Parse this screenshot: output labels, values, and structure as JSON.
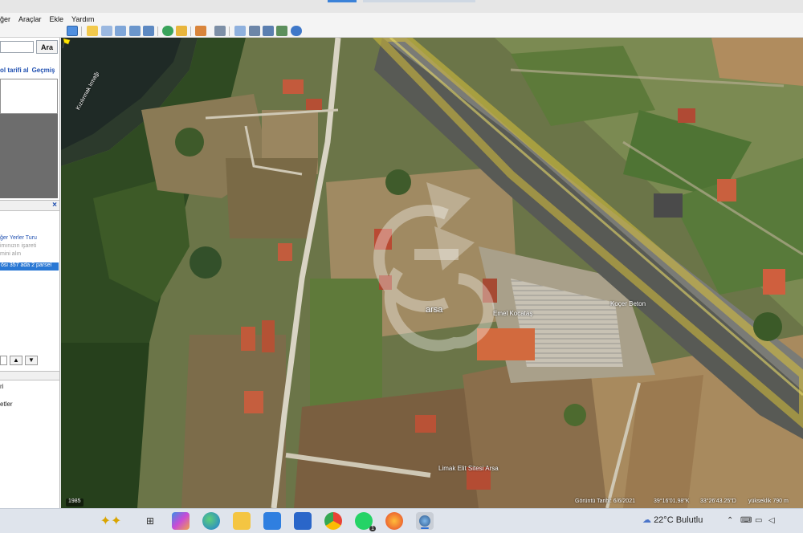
{
  "menu": [
    "ğer",
    "Araçlar",
    "Ekle",
    "Yardım"
  ],
  "search": {
    "button_label": "Ara",
    "value": ""
  },
  "left_tabs": [
    "ol tarifi al",
    "Geçmiş"
  ],
  "places": {
    "close_label": "×",
    "items": [
      "ğer Yerler Turu",
      "imınızın işareti",
      "mini alın",
      "ösi 357 ada 2 parsel"
    ]
  },
  "nav": {
    "up": "▲",
    "down": "▼"
  },
  "layers": [
    "ri",
    "etler"
  ],
  "map": {
    "parcel_label": "arsa",
    "place_labels": [
      "Kızılırmak Irmağı",
      "Emel Kocataş",
      "Koçer Beton",
      "Limak Elit Sitesi Arsa"
    ],
    "year": "1985",
    "status": {
      "imagery_date": "Görüntü Tarihi: 6/6/2021",
      "lat": "39°16'01.98\"K",
      "lon": "33°26'43.25\"D",
      "elev": "yükseklik 790 m"
    }
  },
  "taskbar": {
    "weather_temp": "22°C",
    "weather_text": "Bulutlu",
    "whatsapp_badge": "1"
  }
}
